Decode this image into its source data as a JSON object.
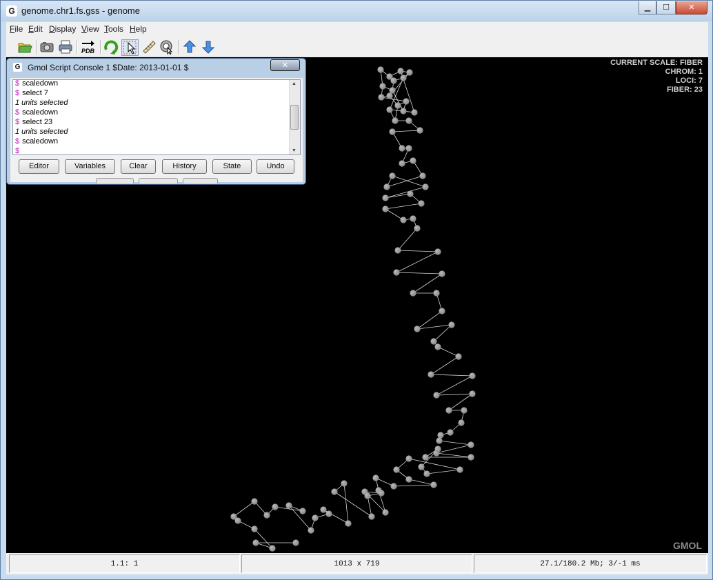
{
  "window": {
    "title": "genome.chr1.fs.gss - genome",
    "app_icon": "G"
  },
  "window_controls": {
    "minimize": "▁",
    "maximize": "☐",
    "close": "✕"
  },
  "menu": [
    "File",
    "Edit",
    "Display",
    "View",
    "Tools",
    "Help"
  ],
  "toolbar": [
    {
      "name": "open-icon"
    },
    {
      "name": "camera-icon"
    },
    {
      "name": "print-icon"
    },
    {
      "name": "export-pdb-icon",
      "label": "PDB"
    },
    {
      "name": "rotate-icon"
    },
    {
      "name": "select-pointer-icon"
    },
    {
      "name": "ruler-icon"
    },
    {
      "name": "pick-center-icon"
    },
    {
      "name": "arrow-up-icon"
    },
    {
      "name": "arrow-down-icon"
    }
  ],
  "viewer": {
    "info": [
      "CURRENT SCALE: FIBER",
      "CHROM: 1",
      "LOCI: 7",
      "FIBER: 23"
    ],
    "watermark": "GMOL",
    "background_color": "#000000",
    "node_color": "#8c8c8c",
    "edge_color": "#d8d8d8"
  },
  "console": {
    "icon": "G",
    "title": "Gmol Script Console 1  $Date: 2013-01-01 $",
    "close": "✕",
    "lines": [
      {
        "type": "cmd",
        "text": "scaledown"
      },
      {
        "type": "cmd",
        "text": "select 7"
      },
      {
        "type": "out",
        "text": "1 units selected"
      },
      {
        "type": "cmd",
        "text": "scaledown"
      },
      {
        "type": "cmd",
        "text": "select 23"
      },
      {
        "type": "out",
        "text": "1 units selected"
      },
      {
        "type": "cmd",
        "text": "scaledown"
      },
      {
        "type": "cmd",
        "text": ""
      }
    ],
    "prompt": "$",
    "buttons": [
      "Editor",
      "Variables",
      "Clear",
      "History",
      "State",
      "Undo"
    ]
  },
  "status": {
    "position": "1.1: 1",
    "size": "1013 x 719",
    "memory": "27.1/180.2 Mb;    3/-1 ms"
  }
}
